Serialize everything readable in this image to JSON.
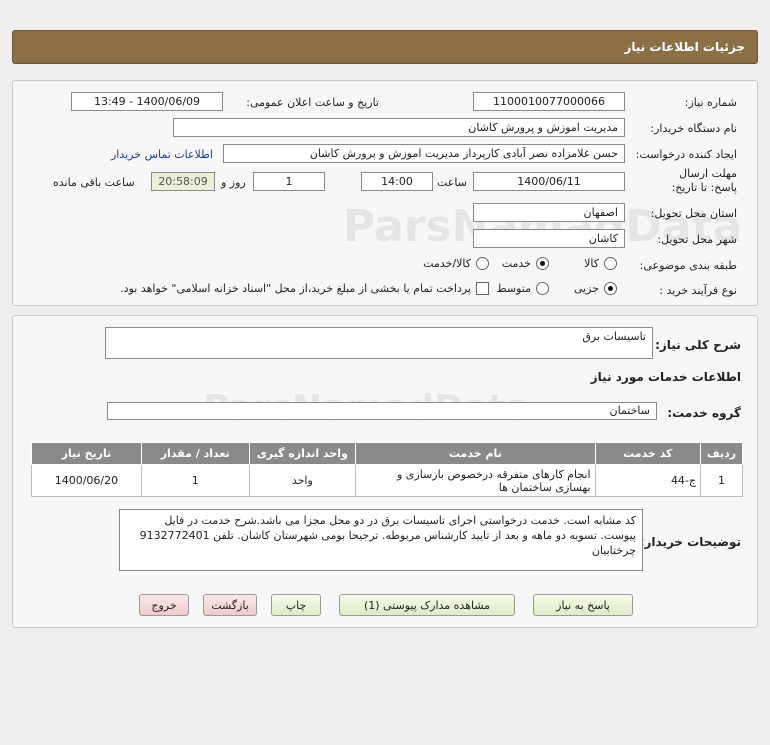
{
  "page_title": "جزئیات اطلاعات نیاز",
  "fields": {
    "need_number_label": "شماره نیاز:",
    "need_number": "1100010077000066",
    "announce_label": "تاریخ و ساعت اعلان عمومی:",
    "announce_value": "1400/06/09 - 13:49",
    "buyer_org_label": "نام دستگاه خریدار:",
    "buyer_org": "مدیریت اموزش و پرورش کاشان",
    "requester_label": "ایجاد کننده درخواست:",
    "requester": "حسن غلامزاده نصر آبادی کارپرداز مدیریت اموزش و پرورش کاشان",
    "contact_link": "اطلاعات تماس خریدار",
    "deadline_label": "مهلت ارسال پاسخ: تا تاریخ:",
    "deadline_date": "1400/06/11",
    "time_label": "ساعت",
    "deadline_time": "14:00",
    "days_count": "1",
    "days_label": "روز و",
    "remaining_time": "20:58:09",
    "remaining_label": "ساعت باقی مانده",
    "province_label": "استان محل تحویل:",
    "province": "اصفهان",
    "city_label": "شهر محل تحویل:",
    "city": "کاشان",
    "category_label": "طبقه بندی موضوعی:",
    "category_options": [
      "کالا",
      "خدمت",
      "کالا/خدمت"
    ],
    "category_selected": "خدمت",
    "process_label": "نوع فرآیند خرید :",
    "process_options": [
      "جزیی",
      "متوسط"
    ],
    "process_selected": "جزیی",
    "payment_note": "پرداخت تمام یا بخشی از مبلغ خرید،از محل \"اسناد خزانه اسلامی\" خواهد بود."
  },
  "summary": {
    "general_desc_label": "شرح کلی نیاز:",
    "general_desc": "تاسیسات برق",
    "services_info_heading": "اطلاعات خدمات مورد نیاز",
    "service_group_label": "گروه خدمت:",
    "service_group": "ساختمان",
    "table": {
      "headers": [
        "ردیف",
        "کد خدمت",
        "نام خدمت",
        "واحد اندازه گیری",
        "تعداد / مقدار",
        "تاریخ نیاز"
      ],
      "rows": [
        [
          "1",
          "ج-44",
          "انجام کارهای متفرقه درخصوص بازسازی و بهسازی ساختمان ها",
          "واحد",
          "1",
          "1400/06/20"
        ]
      ]
    },
    "buyer_notes_label": "توضیحات خریدار:",
    "buyer_notes": "کد مشابه است. خدمت درخواستی اجرای تاسیسات برق در دو محل مجزا می باشد.شرح خدمت در فایل پیوست. تسویه دو ماهه و بعد از تایید کارشناس مربوطه. ترجیحا بومی شهرستان کاشان. تلفن 9132772401 چرختابیان"
  },
  "buttons": {
    "reply": "پاسخ به نیاز",
    "view_docs": "مشاهده مدارک پیوستی (1)",
    "print": "چاپ",
    "back": "بازگشت",
    "exit": "خروج"
  }
}
